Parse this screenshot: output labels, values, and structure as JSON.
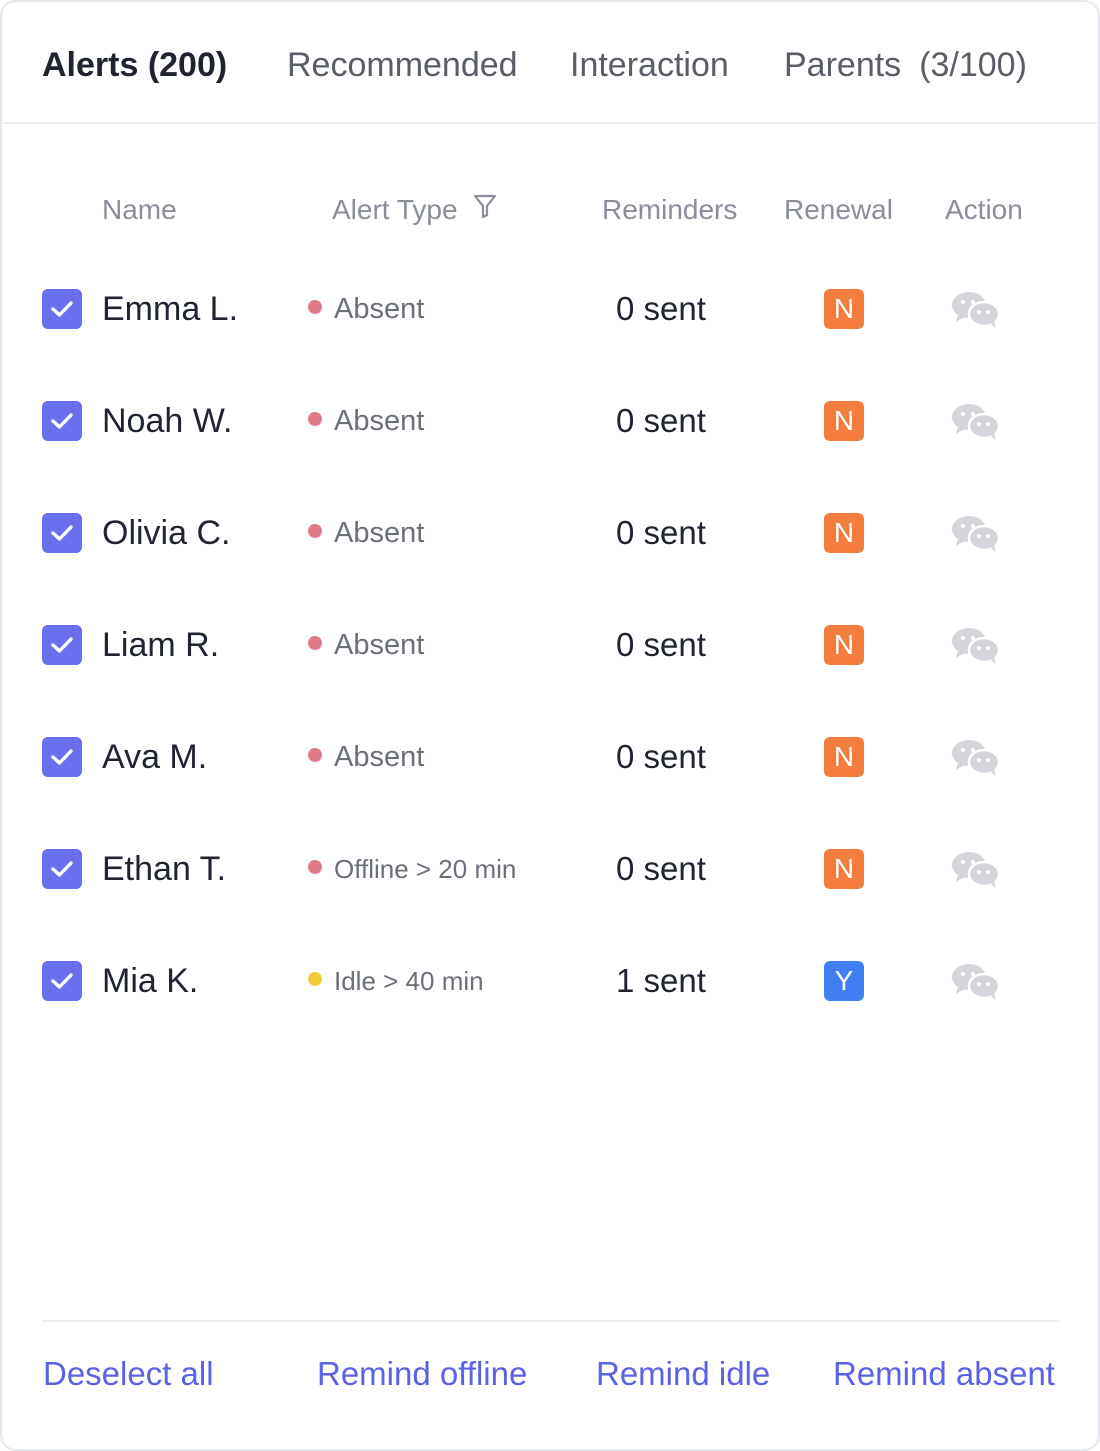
{
  "tabs": [
    {
      "label": "Alerts (200)",
      "active": true
    },
    {
      "label": "Recommended"
    },
    {
      "label": "Interaction"
    },
    {
      "label": "Parents",
      "count": "(3/100)"
    }
  ],
  "table": {
    "headers": {
      "name": "Name",
      "alert_type": "Alert Type",
      "reminders": "Reminders",
      "renewal": "Renewal",
      "action": "Action"
    },
    "rows": [
      {
        "name": "Emma L.",
        "alert": "Absent",
        "alert_color": "#e27a8c",
        "reminders": "0 sent",
        "renewal": "N",
        "renewal_color": "#f47c3c",
        "checked": true
      },
      {
        "name": "Noah W.",
        "alert": "Absent",
        "alert_color": "#e27a8c",
        "reminders": "0 sent",
        "renewal": "N",
        "renewal_color": "#f47c3c",
        "checked": true
      },
      {
        "name": "Olivia C.",
        "alert": "Absent",
        "alert_color": "#e27a8c",
        "reminders": "0 sent",
        "renewal": "N",
        "renewal_color": "#f47c3c",
        "checked": true
      },
      {
        "name": "Liam R.",
        "alert": "Absent",
        "alert_color": "#e27a8c",
        "reminders": "0 sent",
        "renewal": "N",
        "renewal_color": "#f47c3c",
        "checked": true
      },
      {
        "name": "Ava M.",
        "alert": "Absent",
        "alert_color": "#e27a8c",
        "reminders": "0 sent",
        "renewal": "N",
        "renewal_color": "#f47c3c",
        "checked": true
      },
      {
        "name": "Ethan T.",
        "alert": "Offline > 20 min",
        "alert_color": "#e27a8c",
        "reminders": "0 sent",
        "renewal": "N",
        "renewal_color": "#f47c3c",
        "checked": true
      },
      {
        "name": "Mia K.",
        "alert": "Idle > 40 min",
        "alert_color": "#f5cd3c",
        "reminders": "1 sent",
        "renewal": "Y",
        "renewal_color": "#3f7ff2",
        "checked": true
      }
    ]
  },
  "footer": {
    "deselect_all": "Deselect all",
    "remind_offline": "Remind offline",
    "remind_idle": "Remind idle",
    "remind_absent": "Remind absent"
  },
  "colors": {
    "accent": "#6a6ff0",
    "link": "#5a62e6",
    "absent_dot": "#e27a8c",
    "idle_dot": "#f5cd3c",
    "renewal_no": "#f47c3c",
    "renewal_yes": "#3f7ff2",
    "action_icon": "#d3d5db"
  },
  "icons": {
    "checkbox": "check-icon",
    "filter": "filter-icon",
    "action": "wechat-icon"
  }
}
